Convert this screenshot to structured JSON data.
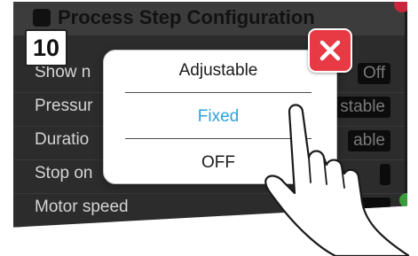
{
  "step_number": "10",
  "screen": {
    "title": "Process Step Configuration",
    "rows": [
      {
        "label": "Show n",
        "value": "Off"
      },
      {
        "label": "Pressur",
        "value": "stable"
      },
      {
        "label": "Duratio",
        "value": "able"
      },
      {
        "label": "Stop on",
        "value": ""
      },
      {
        "label": "Motor speed",
        "value": ""
      }
    ]
  },
  "popup": {
    "options": [
      {
        "label": "Adjustable",
        "selected": false
      },
      {
        "label": "Fixed",
        "selected": true
      },
      {
        "label": "OFF",
        "selected": false
      }
    ]
  },
  "colors": {
    "selected_text": "#2aa3dd",
    "close_button": "#e83a45"
  },
  "icons": {
    "close": "close-icon",
    "hand": "pointing-hand-icon",
    "gear": "gear-icon"
  }
}
